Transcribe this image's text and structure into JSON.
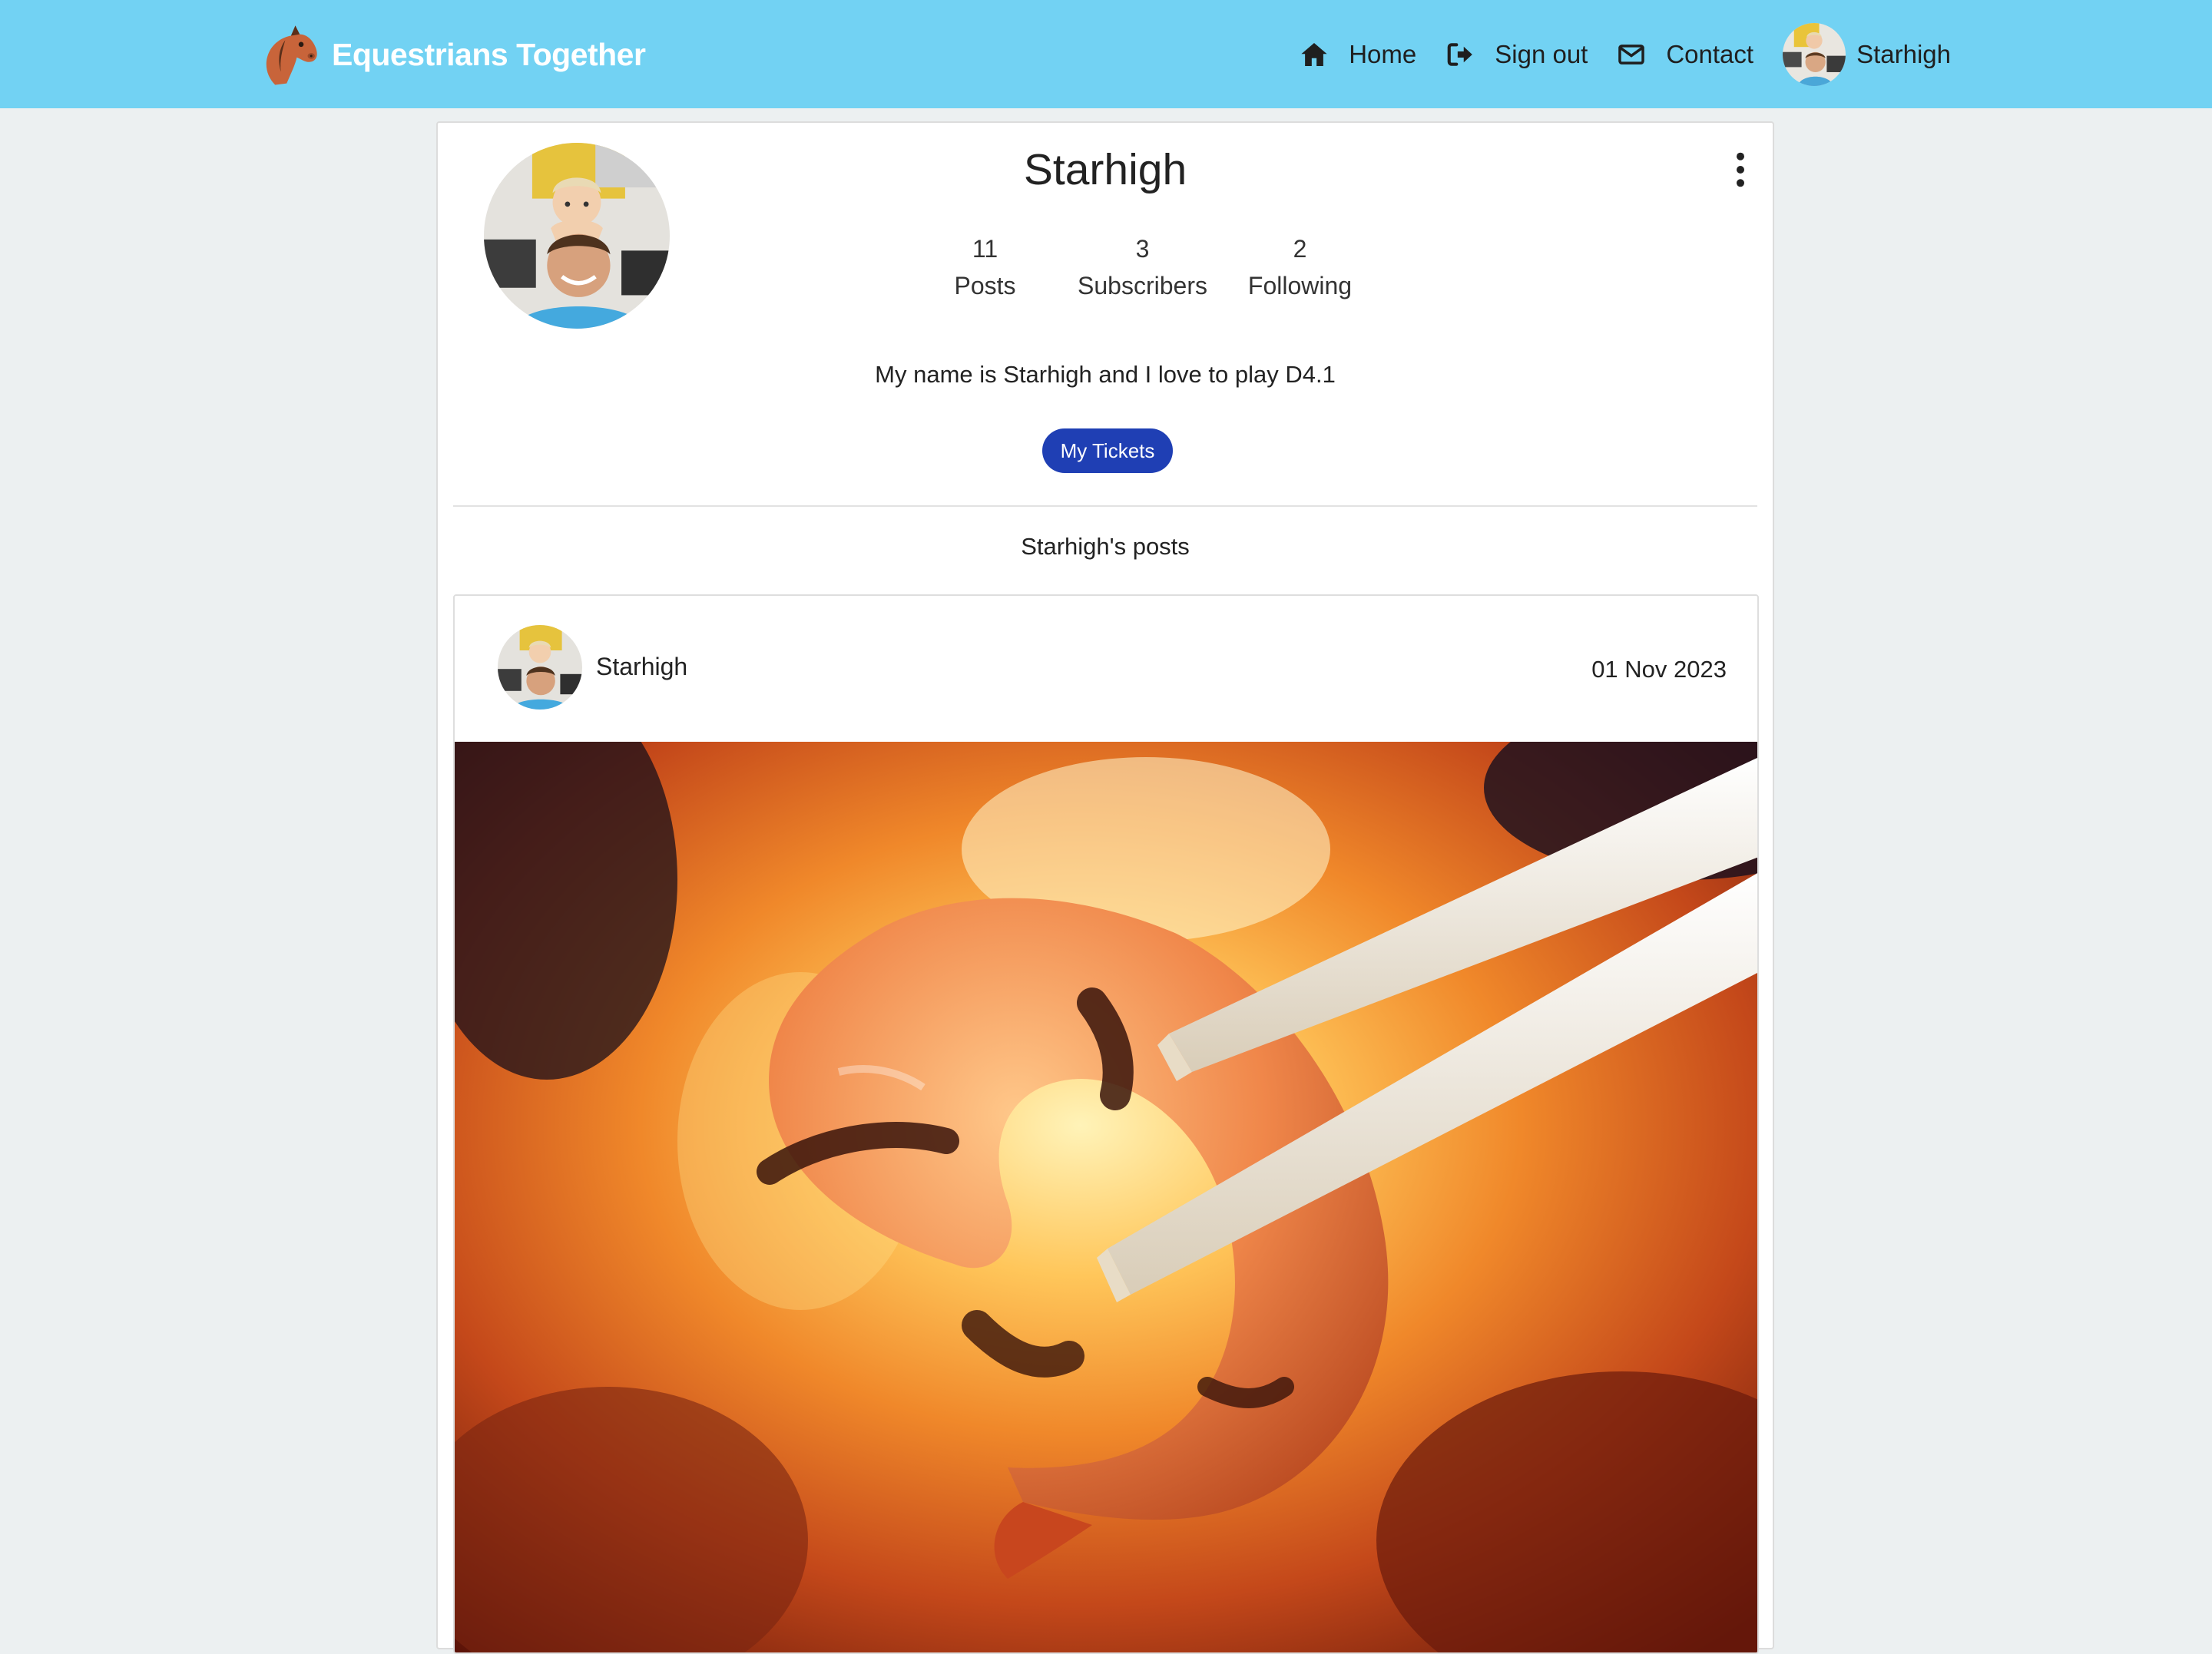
{
  "navbar": {
    "brand_title": "Equestrians Together",
    "brand_icon": "horse-head-icon",
    "links": [
      {
        "label": "Home",
        "icon": "home-icon"
      },
      {
        "label": "Sign out",
        "icon": "sign-out-icon"
      },
      {
        "label": "Contact",
        "icon": "envelope-icon"
      }
    ],
    "user": {
      "name": "Starhigh",
      "avatar": "user-avatar"
    },
    "colors": {
      "background": "#72d2f3",
      "brand_text": "#ffffff"
    }
  },
  "profile": {
    "name": "Starhigh",
    "stats": [
      {
        "value": "11",
        "label": "Posts"
      },
      {
        "value": "3",
        "label": "Subscribers"
      },
      {
        "value": "2",
        "label": "Following"
      }
    ],
    "bio": "My name is Starhigh and I love to play D4.1",
    "tickets_button": "My Tickets",
    "menu_icon": "more-vertical-icon",
    "colors": {
      "button": "#1f3fb4"
    }
  },
  "posts_section": {
    "heading": "Starhigh's posts",
    "posts": [
      {
        "author": "Starhigh",
        "date": "01 Nov 2023",
        "image": "grilled-shrimp-on-chopsticks-photo"
      }
    ]
  }
}
